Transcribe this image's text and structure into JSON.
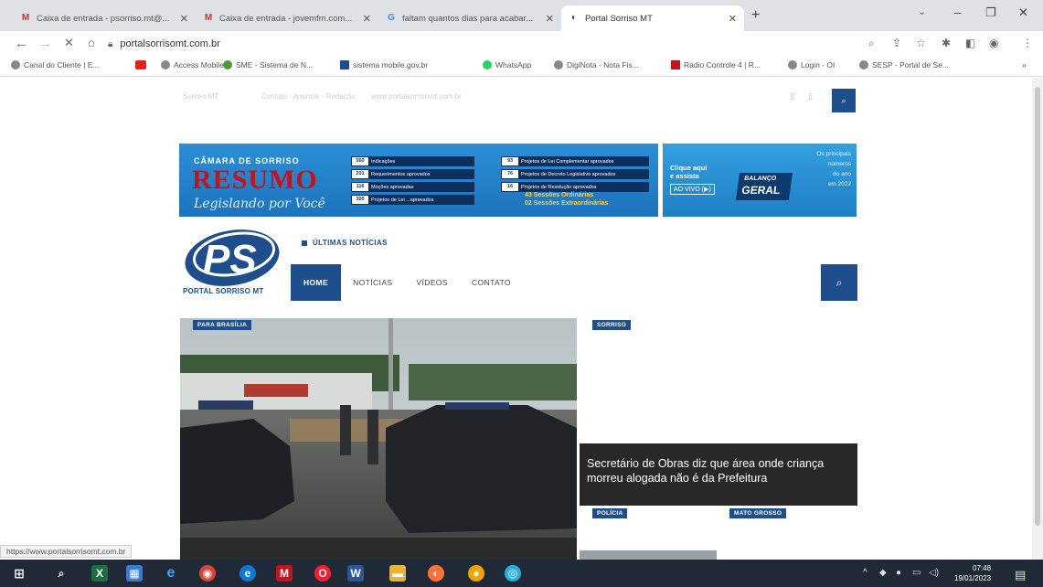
{
  "browser": {
    "tabs": [
      {
        "title": "Caixa de entrada - psorriso.mt@...",
        "icon": "gmail-icon"
      },
      {
        "title": "Caixa de entrada - jovemfm.com...",
        "icon": "gmail-icon"
      },
      {
        "title": "faltam quantos dias para acabar...",
        "icon": "google-icon"
      },
      {
        "title": "Portal Sorriso MT",
        "icon": "portal-favicon-icon"
      }
    ],
    "new_tab": "+",
    "url": "portalsorrisomt.com.br",
    "bookmarks": [
      "Canal do Cliente | E...",
      "",
      "Access Mobile",
      "SME - Sistema de N...",
      "sistema mobile.gov.br",
      "WhatsApp",
      "DigiNota - Nota Fis...",
      "Radio Controle 4 | R...",
      "Login - OI",
      "SESP - Portal de Se..."
    ],
    "status_url": "https://www.portalsorrisomt.com.br"
  },
  "site": {
    "topbar_faint": [
      "Sorriso MT",
      "Contato · Anuncie · Redação",
      "www.portalsorrisomt.com.br"
    ],
    "banner1": {
      "kicker": "CÂMARA DE SORRISO",
      "title": "RESUMO",
      "script": "Legislando por Você",
      "col1": [
        {
          "n": "560",
          "label": "Indicações"
        },
        {
          "n": "201",
          "label": "Requerimentos aprovados"
        },
        {
          "n": "116",
          "label": "Moções aprovadas"
        },
        {
          "n": "300",
          "label": "Projetos de Lei ...aprovados"
        }
      ],
      "col2": [
        {
          "n": "93",
          "label": "Projetos de Lei Complementar aprovados"
        },
        {
          "n": "76",
          "label": "Projetos de Decreto Legislativo aprovados"
        },
        {
          "n": "16",
          "label": "Projetos de Resolução aprovados"
        }
      ],
      "sessions": "43 Sessões Ordinárias\n02 Sessões Extraordinárias"
    },
    "banner2": {
      "click": "Clique aqui\ne assista",
      "live": "AO VIVO (▶)",
      "balanco": "BALANÇO",
      "geral": "GERAL",
      "right": "Os principais\nnúmeros\ndo ano\nem 2022"
    },
    "logo_text": "PS",
    "logo_name": "PORTAL SORRISO MT",
    "ultimas": "ÚLTIMAS NOTÍCIAS",
    "nav": [
      "HOME",
      "NOTÍCIAS",
      "VÍDEOS",
      "CONTATO"
    ],
    "cards": {
      "main_tag": "PARA BRASÍLIA",
      "side_tag": "SORRISO",
      "side_title": "Secretário de Obras diz que área onde criança morreu alogada não é da Prefeitura",
      "bottom_tag_left": "POLÍCIA",
      "bottom_tag_right": "MATO GROSSO"
    }
  },
  "taskbar": {
    "time": "07:48",
    "date": "19/01/2023"
  },
  "colors": {
    "brand": "#1f4e8c",
    "banner_blue": "#1d73bd",
    "resumo_red": "#c8121a"
  }
}
